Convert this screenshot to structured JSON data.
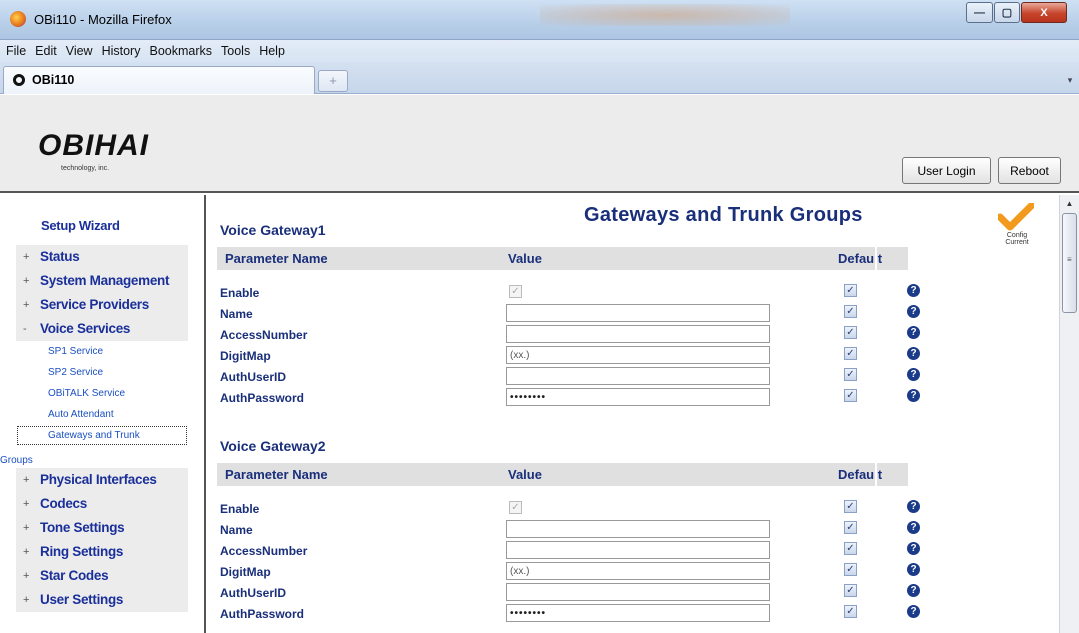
{
  "window": {
    "title": "OBi110 - Mozilla Firefox",
    "min_glyph": "—",
    "max_glyph": "▢",
    "close_glyph": "X"
  },
  "menubar": {
    "items": [
      {
        "label": "File"
      },
      {
        "label": "Edit"
      },
      {
        "label": "View"
      },
      {
        "label": "History"
      },
      {
        "label": "Bookmarks"
      },
      {
        "label": "Tools"
      },
      {
        "label": "Help"
      }
    ]
  },
  "tabs": {
    "active_label": "OBi110",
    "new_tab_glyph": "+",
    "list_glyph": "▾"
  },
  "header": {
    "logo": "OBIHAI",
    "logo_sub": "technology, inc.",
    "user_login_label": "User Login",
    "reboot_label": "Reboot"
  },
  "sidebar": {
    "setup_wizard": "Setup Wizard",
    "top_items": [
      {
        "sign": "+",
        "label": "Status"
      },
      {
        "sign": "+",
        "label": "System Management"
      },
      {
        "sign": "+",
        "label": "Service Providers"
      },
      {
        "sign": "-",
        "label": "Voice Services"
      }
    ],
    "voice_sub_items": [
      {
        "label": "SP1 Service"
      },
      {
        "label": "SP2 Service"
      },
      {
        "label": "OBiTALK Service"
      },
      {
        "label": "Auto Attendant"
      },
      {
        "label": "Gateways and Trunk"
      }
    ],
    "groups_wrap": "Groups",
    "bottom_items": [
      {
        "sign": "+",
        "label": "Physical Interfaces"
      },
      {
        "sign": "+",
        "label": "Codecs"
      },
      {
        "sign": "+",
        "label": "Tone Settings"
      },
      {
        "sign": "+",
        "label": "Ring Settings"
      },
      {
        "sign": "+",
        "label": "Star Codes"
      },
      {
        "sign": "+",
        "label": "User Settings"
      }
    ]
  },
  "content": {
    "page_title": "Gateways and Trunk Groups",
    "config_status": "Config Current",
    "check_color": "#f29a1e",
    "columns": {
      "parameter": "Parameter Name",
      "value": "Value",
      "default": "Default"
    },
    "help_glyph": "?",
    "check_glyph": "✓",
    "gateways": [
      {
        "title": "Voice Gateway1",
        "rows": [
          {
            "name": "Enable",
            "kind": "checkbox",
            "value": ""
          },
          {
            "name": "Name",
            "kind": "text",
            "value": ""
          },
          {
            "name": "AccessNumber",
            "kind": "text",
            "value": ""
          },
          {
            "name": "DigitMap",
            "kind": "text",
            "value": "(xx.)"
          },
          {
            "name": "AuthUserID",
            "kind": "text",
            "value": ""
          },
          {
            "name": "AuthPassword",
            "kind": "password",
            "value": "••••••••"
          }
        ]
      },
      {
        "title": "Voice Gateway2",
        "rows": [
          {
            "name": "Enable",
            "kind": "checkbox",
            "value": ""
          },
          {
            "name": "Name",
            "kind": "text",
            "value": ""
          },
          {
            "name": "AccessNumber",
            "kind": "text",
            "value": ""
          },
          {
            "name": "DigitMap",
            "kind": "text",
            "value": "(xx.)"
          },
          {
            "name": "AuthUserID",
            "kind": "text",
            "value": ""
          },
          {
            "name": "AuthPassword",
            "kind": "password",
            "value": "••••••••"
          }
        ]
      }
    ]
  }
}
